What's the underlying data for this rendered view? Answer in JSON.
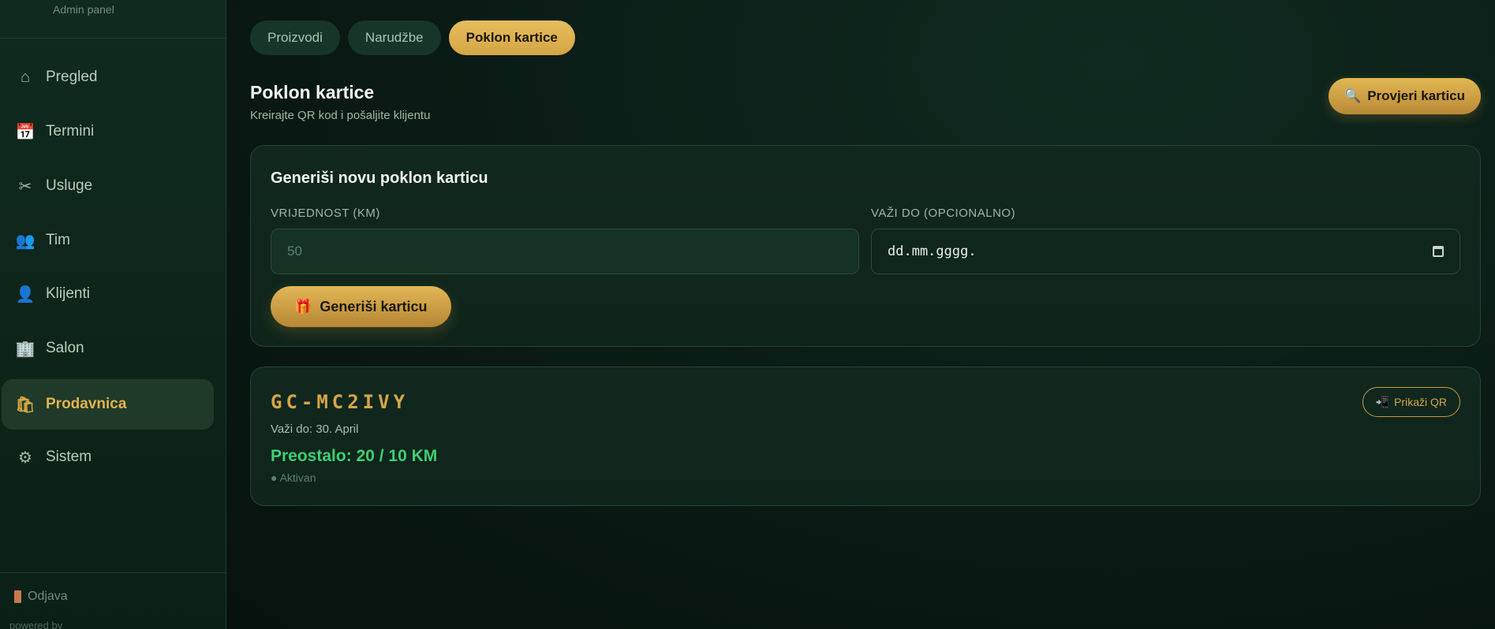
{
  "sidebar": {
    "brand_subtitle": "Admin panel",
    "items": [
      {
        "label": "Pregled",
        "icon": "⌂"
      },
      {
        "label": "Termini",
        "icon": "📅"
      },
      {
        "label": "Usluge",
        "icon": "✂"
      },
      {
        "label": "Tim",
        "icon": "👥"
      },
      {
        "label": "Klijenti",
        "icon": "👤"
      },
      {
        "label": "Salon",
        "icon": "🏢"
      },
      {
        "label": "Prodavnica",
        "icon": "🛍"
      },
      {
        "label": "Sistem",
        "icon": "⚙"
      }
    ],
    "active_index": 6,
    "logout_label": "Odjava",
    "powered_by": "powered by"
  },
  "tabs": [
    {
      "label": "Proizvodi"
    },
    {
      "label": "Narudžbe"
    },
    {
      "label": "Poklon kartice"
    }
  ],
  "active_tab": 2,
  "header": {
    "title": "Poklon kartice",
    "subtitle": "Kreirajte QR kod i pošaljite klijentu",
    "check_button": "Provjeri karticu",
    "check_icon": "🔍"
  },
  "form": {
    "title": "Generiši novu poklon karticu",
    "value_label": "VRIJEDNOST (KM)",
    "value_placeholder": "50",
    "date_label": "VAŽI DO (OPCIONALNO)",
    "date_placeholder": "dd.mm.gggg.",
    "generate_button": "Generiši karticu",
    "generate_icon": "🎁"
  },
  "gift_card": {
    "code": "GC-MC2IVY",
    "valid_until": "Važi do: 30. April",
    "remaining": "Preostalo: 20 / 10 KM",
    "status": "● Aktivan",
    "qr_button": "Prikaži QR",
    "qr_icon": "📲"
  },
  "colors": {
    "accent_gold": "#d9a646",
    "success_green": "#3fcf73",
    "background": "#0a1612"
  }
}
